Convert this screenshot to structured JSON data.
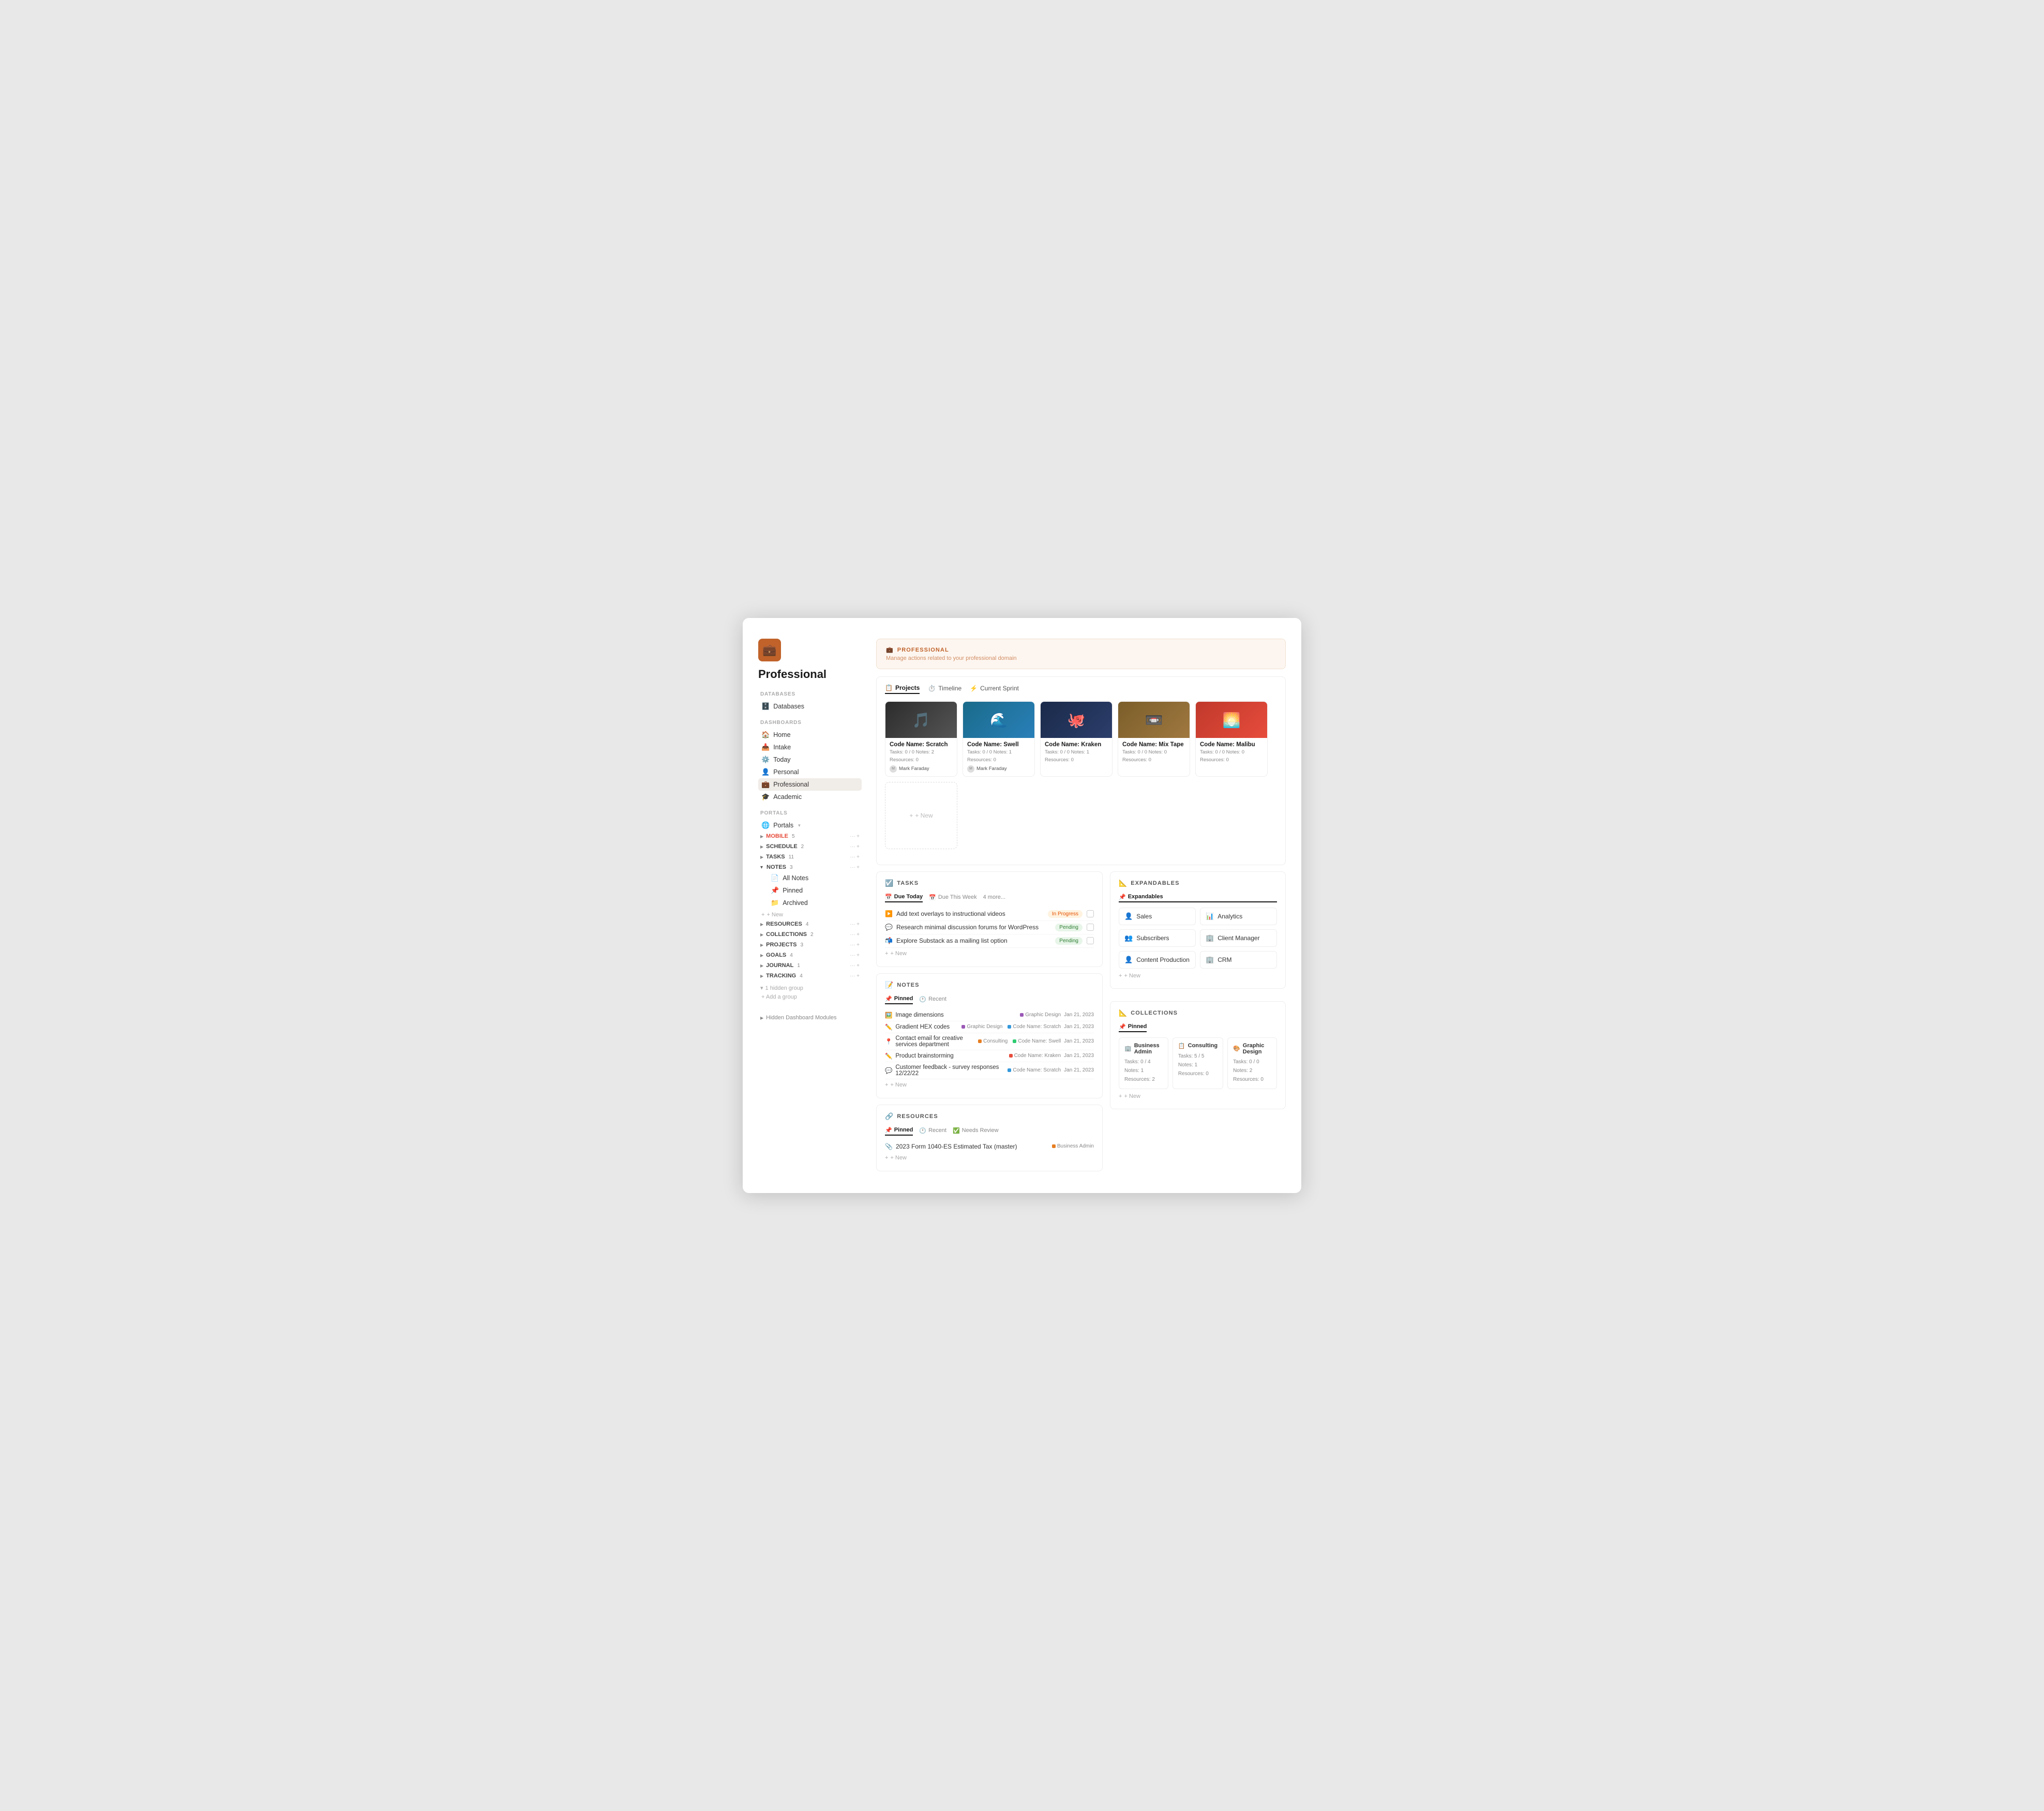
{
  "page": {
    "title": "Professional",
    "icon": "💼",
    "banner": {
      "label": "PROFESSIONAL",
      "subtitle": "Manage actions related to your professional domain"
    }
  },
  "sidebar": {
    "databases_label": "DATABASES",
    "databases_item": "Databases",
    "dashboards_label": "DASHBOARDS",
    "dashboards": [
      {
        "label": "Home",
        "icon": "🏠"
      },
      {
        "label": "Intake",
        "icon": "📥"
      },
      {
        "label": "Today",
        "icon": "⚙️"
      },
      {
        "label": "Personal",
        "icon": "👤"
      },
      {
        "label": "Professional",
        "icon": "💼",
        "active": true
      },
      {
        "label": "Academic",
        "icon": "🎓"
      }
    ],
    "portals_label": "PORTALS",
    "portals_item": "Portals",
    "groups": [
      {
        "label": "MOBILE",
        "badge": "5",
        "expanded": false,
        "color": "#e74c3c"
      },
      {
        "label": "SCHEDULE",
        "badge": "2",
        "expanded": false
      },
      {
        "label": "TASKS",
        "badge": "11",
        "expanded": false
      },
      {
        "label": "NOTES",
        "badge": "3",
        "expanded": true
      },
      {
        "label": "RESOURCES",
        "badge": "4",
        "expanded": false
      },
      {
        "label": "COLLECTIONS",
        "badge": "2",
        "expanded": false
      },
      {
        "label": "PROJECTS",
        "badge": "3",
        "expanded": false
      },
      {
        "label": "GOALS",
        "badge": "4",
        "expanded": false
      },
      {
        "label": "JOURNAL",
        "badge": "1",
        "expanded": false
      },
      {
        "label": "TRACKING",
        "badge": "4",
        "expanded": false
      }
    ],
    "notes_sub": [
      {
        "label": "All Notes",
        "icon": "📄",
        "active": false
      },
      {
        "label": "Pinned",
        "icon": "📌",
        "active": false
      },
      {
        "label": "Archived",
        "icon": "📁",
        "active": false
      }
    ],
    "add_new_label": "+ New",
    "hidden_group": "1 hidden group",
    "add_group": "+ Add a group",
    "hidden_modules": "Hidden Dashboard Modules"
  },
  "projects": {
    "section_tabs": [
      "Projects",
      "Timeline",
      "Current Sprint"
    ],
    "items": [
      {
        "name": "Code Name: Scratch",
        "tasks": "Tasks: 0 / 0",
        "notes": "Notes: 2",
        "resources": "Resources: 0",
        "author": "Mark Faraday",
        "thumb_color": "#2c2c2c",
        "thumb_emoji": "🎵"
      },
      {
        "name": "Code Name: Swell",
        "tasks": "Tasks: 0 / 0",
        "notes": "Notes: 1",
        "resources": "Resources: 0",
        "author": "Mark Faraday",
        "thumb_color": "#1a6b8a",
        "thumb_emoji": "🌊"
      },
      {
        "name": "Code Name: Kraken",
        "tasks": "Tasks: 0 / 0",
        "notes": "Notes: 1",
        "resources": "Resources: 0",
        "thumb_color": "#1a2a4a",
        "thumb_emoji": "🐙"
      },
      {
        "name": "Code Name: Mix Tape",
        "tasks": "Tasks: 0 / 0",
        "notes": "Notes: 0",
        "resources": "Resources: 0",
        "thumb_color": "#7b5e2a",
        "thumb_emoji": "📼"
      },
      {
        "name": "Code Name: Malibu",
        "tasks": "Tasks: 0 / 0",
        "notes": "Notes: 0",
        "resources": "Resources: 0",
        "thumb_color": "#c0392b",
        "thumb_emoji": "🌅"
      }
    ],
    "add_label": "+ New"
  },
  "tasks": {
    "section_title": "TASKS",
    "tabs": [
      "Due Today",
      "Due This Week",
      "4 more..."
    ],
    "items": [
      {
        "label": "Add text overlays to instructional videos",
        "status": "In Progress",
        "status_class": "status-in-progress",
        "icon": "▶️"
      },
      {
        "label": "Research minimal discussion forums for WordPress",
        "status": "Pending",
        "status_class": "status-pending",
        "icon": "💬"
      },
      {
        "label": "Explore Substack as a mailing list option",
        "status": "Pending",
        "status_class": "status-pending",
        "icon": "📬"
      }
    ],
    "add_label": "+ New"
  },
  "notes": {
    "section_title": "NOTES",
    "tabs": [
      "Pinned",
      "Recent"
    ],
    "items": [
      {
        "label": "Image dimensions",
        "tag": "Graphic Design",
        "tag_color": "#9b59b6",
        "ref": "",
        "date": "Jan 21, 2023",
        "icon": "🖼️"
      },
      {
        "label": "Gradient HEX codes",
        "tag": "Graphic Design",
        "tag_color": "#9b59b6",
        "ref": "Code Name: Scratch",
        "date": "Jan 21, 2023",
        "icon": "✏️"
      },
      {
        "label": "Contact email for creative services department",
        "tag": "Consulting",
        "tag_color": "#e67e22",
        "ref": "Code Name: Swell",
        "date": "Jan 21, 2023",
        "icon": "📍"
      },
      {
        "label": "Product brainstorming",
        "tag": "",
        "tag_color": "",
        "ref": "Code Name: Kraken",
        "date": "Jan 21, 2023",
        "icon": "✏️"
      },
      {
        "label": "Customer feedback - survey responses 12/22/22",
        "tag": "",
        "tag_color": "",
        "ref": "Code Name: Scratch",
        "date": "Jan 21, 2023",
        "icon": "💬"
      }
    ],
    "add_label": "+ New"
  },
  "resources": {
    "section_title": "RESOURCES",
    "tabs": [
      "Pinned",
      "Recent",
      "Needs Review"
    ],
    "items": [
      {
        "label": "2023 Form 1040-ES Estimated Tax (master)",
        "tag": "Business Admin",
        "tag_color": "#e67e22",
        "icon": "📎"
      }
    ],
    "add_label": "+ New"
  },
  "expandables": {
    "section_title": "EXPANDABLES",
    "tab": "Expandables",
    "items": [
      {
        "label": "Sales",
        "icon": "👤",
        "icon_color": "#e67e22"
      },
      {
        "label": "Analytics",
        "icon": "📊",
        "icon_color": "#3498db"
      },
      {
        "label": "Subscribers",
        "icon": "👥",
        "icon_color": "#e67e22"
      },
      {
        "label": "Client Manager",
        "icon": "🏢",
        "icon_color": "#9b59b6"
      },
      {
        "label": "Content Production",
        "icon": "👤",
        "icon_color": "#e67e22"
      },
      {
        "label": "CRM",
        "icon": "🏢",
        "icon_color": "#3498db"
      }
    ],
    "add_label": "+ New"
  },
  "collections": {
    "section_title": "COLLECTIONS",
    "tab": "Pinned",
    "items": [
      {
        "name": "Business Admin",
        "icon": "🏢",
        "icon_color": "#e67e22",
        "tasks": "Tasks: 0 / 4",
        "notes": "Notes: 1",
        "resources": "Resources: 2"
      },
      {
        "name": "Consulting",
        "icon": "📋",
        "icon_color": "#9b59b6",
        "tasks": "Tasks: 5 / 5",
        "notes": "Notes: 1",
        "resources": "Resources: 0"
      },
      {
        "name": "Graphic Design",
        "icon": "🎨",
        "icon_color": "#e67e22",
        "tasks": "Tasks: 0 / 0",
        "notes": "Notes: 2",
        "resources": "Resources: 0"
      }
    ],
    "add_label": "+ New"
  }
}
